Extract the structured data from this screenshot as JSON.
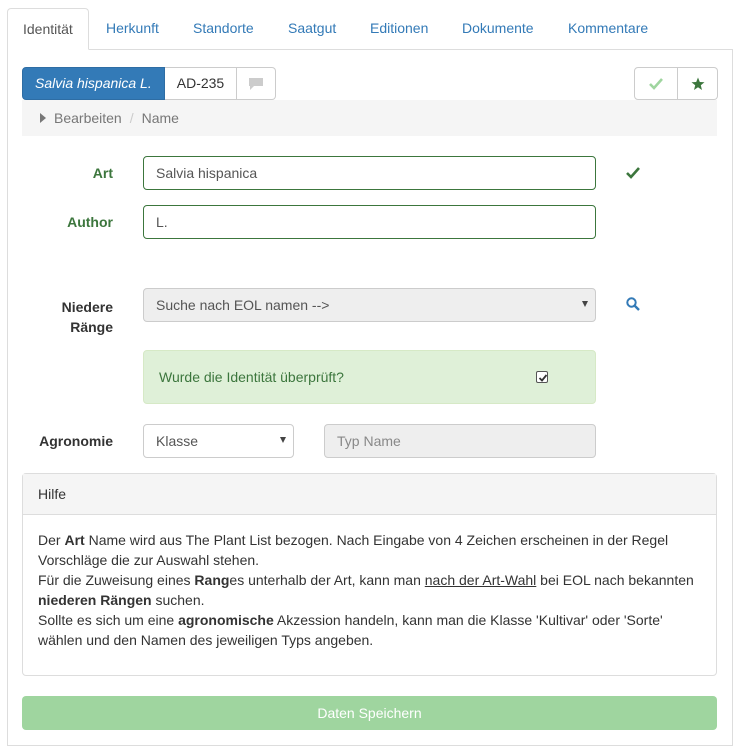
{
  "tabs": [
    "Identität",
    "Herkunft",
    "Standorte",
    "Saatgut",
    "Editionen",
    "Dokumente",
    "Kommentare"
  ],
  "header": {
    "species_button": "Salvia hispanica L.",
    "accession_id": "AD-235"
  },
  "breadcrumb": {
    "item1": "Bearbeiten",
    "item2": "Name"
  },
  "form": {
    "art_label": "Art",
    "art_value": "Salvia hispanica",
    "author_label": "Author",
    "author_value": "L.",
    "niedere_label_1": "Niedere",
    "niedere_label_2": "Ränge",
    "niedere_select": "Suche nach EOL namen -->",
    "verified_label": "Wurde die Identität überprüft?",
    "verified_checked": true,
    "agronomie_label": "Agronomie",
    "agronomie_select": "Klasse",
    "typ_placeholder": "Typ Name"
  },
  "help": {
    "title": "Hilfe",
    "l1a": "Der ",
    "l1b": "Art",
    "l1c": " Name wird aus The Plant List bezogen. Nach Eingabe von 4 Zeichen erscheinen in der Regel Vorschläge die zur Auswahl stehen.",
    "l2a": "Für die Zuweisung eines ",
    "l2b": "Rang",
    "l2c": "es unterhalb der Art, kann man ",
    "l2d": "nach der Art-Wahl",
    "l2e": " bei EOL nach bekannten ",
    "l2f": "niederen Rängen",
    "l2g": " suchen.",
    "l3a": "Sollte es sich um eine ",
    "l3b": "agronomische",
    "l3c": " Akzession handeln, kann man die Klasse 'Kultivar' oder 'Sorte' wählen und den Namen des jeweiligen Typs angeben."
  },
  "save_label": "Daten Speichern",
  "colors": {
    "primary": "#337ab7",
    "success": "#3c763d",
    "save_button": "#9fd59f"
  },
  "icons": [
    "comment-icon",
    "check-icon",
    "star-icon",
    "search-icon",
    "caret-right-icon"
  ]
}
